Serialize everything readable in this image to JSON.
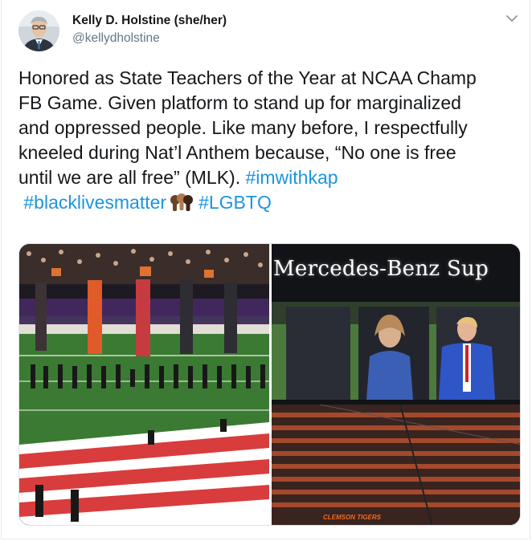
{
  "tweet": {
    "display_name": "Kelly D. Holstine (she/her)",
    "handle": "@kellydholstine",
    "text_lines": [
      "Honored as State Teachers of the Year at NCAA Champ",
      "FB Game. Given platform to stand up for marginalized",
      "and oppressed people. Like many before, I respectfully",
      "kneeled during Nat’l Anthem because, “No one is free"
    ],
    "line5_text": "until we are all free” (MLK). ",
    "hashtags": {
      "imwithkap": "#imwithkap",
      "blacklivesmatter": "#blacklivesmatter",
      "lgbtq": "#LGBTQ"
    },
    "emoji_name": "raised-fists-emoji"
  },
  "media": {
    "right_image": {
      "jumbotron_text": "Mercedes-Benz  Sup",
      "banner_text": "CLEMSON TIGERS"
    }
  },
  "icons": {
    "caret": "chevron-down-icon"
  },
  "colors": {
    "hashtag": "#1b95e0",
    "handle": "#657786",
    "name": "#14171a"
  }
}
